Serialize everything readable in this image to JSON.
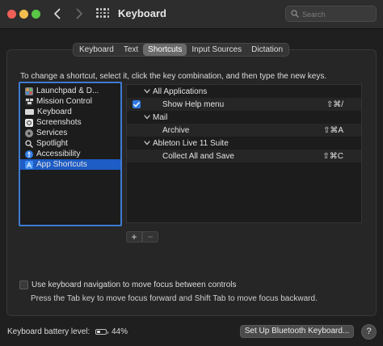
{
  "window": {
    "title": "Keyboard",
    "search_placeholder": "Search"
  },
  "tabs": [
    {
      "label": "Keyboard",
      "active": false
    },
    {
      "label": "Text",
      "active": false
    },
    {
      "label": "Shortcuts",
      "active": true
    },
    {
      "label": "Input Sources",
      "active": false
    },
    {
      "label": "Dictation",
      "active": false
    }
  ],
  "instruction": "To change a shortcut, select it, click the key combination, and then type the new keys.",
  "categories": [
    {
      "label": "Launchpad & D...",
      "icon": "launchpad-icon",
      "selected": false
    },
    {
      "label": "Mission Control",
      "icon": "mission-control-icon",
      "selected": false
    },
    {
      "label": "Keyboard",
      "icon": "keyboard-icon",
      "selected": false
    },
    {
      "label": "Screenshots",
      "icon": "screenshot-icon",
      "selected": false
    },
    {
      "label": "Services",
      "icon": "gear-icon",
      "selected": false
    },
    {
      "label": "Spotlight",
      "icon": "magnifier-icon",
      "selected": false
    },
    {
      "label": "Accessibility",
      "icon": "accessibility-icon",
      "selected": false
    },
    {
      "label": "App Shortcuts",
      "icon": "app-store-icon",
      "selected": true
    }
  ],
  "shortcuts": [
    {
      "type": "group",
      "label": "All Applications"
    },
    {
      "type": "item",
      "label": "Show Help menu",
      "keys": "⇧⌘/",
      "checked": true
    },
    {
      "type": "group",
      "label": "Mail"
    },
    {
      "type": "item",
      "label": "Archive",
      "keys": "⇧⌘A",
      "checked": false
    },
    {
      "type": "group",
      "label": "Ableton Live 11 Suite"
    },
    {
      "type": "item",
      "label": "Collect All and Save",
      "keys": "⇧⌘C",
      "checked": false
    }
  ],
  "buttons": {
    "add": "+",
    "remove": "−",
    "bluetooth": "Set Up Bluetooth Keyboard...",
    "help": "?"
  },
  "keyboard_navigation": {
    "label": "Use keyboard navigation to move focus between controls",
    "hint": "Press the Tab key to move focus forward and Shift Tab to move focus backward.",
    "checked": false
  },
  "battery": {
    "label": "Keyboard battery level:",
    "percent_text": "44%",
    "level": 0.44
  },
  "colors": {
    "accent": "#1e5cc6",
    "focus_ring": "#3f7bd1",
    "checkbox": "#2f7ae5"
  }
}
